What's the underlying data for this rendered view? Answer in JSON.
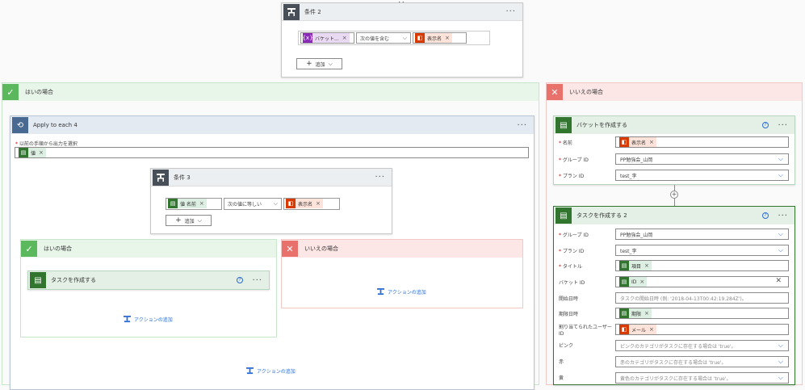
{
  "condition2": {
    "title": "条件 2",
    "token_left": "バケット...",
    "operator": "次の値を含む",
    "token_right": "表示名",
    "add_label": "追加"
  },
  "yes_branch": {
    "title": "はいの場合"
  },
  "no_branch": {
    "title": "いいえの場合"
  },
  "apply_each": {
    "title": "Apply to each 4",
    "select_label": "以前の手順から出力を選択",
    "token": "値"
  },
  "condition3": {
    "title": "条件 3",
    "token_left": "値 名前",
    "operator": "次の値に等しい",
    "token_right": "表示名",
    "add_label": "追加"
  },
  "inner_yes": {
    "title": "はいの場合",
    "task_title": "タスクを作成する",
    "add_action": "アクションの追加"
  },
  "inner_no": {
    "title": "いいえの場合",
    "add_action": "アクションの追加"
  },
  "outer_add_action": "アクションの追加",
  "create_bucket": {
    "title": "バケットを作成する",
    "name_label": "名前",
    "name_token": "表示名",
    "group_label": "グループ ID",
    "group_value": "PP勉強会_山岡",
    "plan_label": "プラン ID",
    "plan_value": "test_李"
  },
  "create_task2": {
    "title": "タスクを作成する 2",
    "group_label": "グループ ID",
    "group_value": "PP勉強会_山岡",
    "plan_label": "プラン ID",
    "plan_value": "test_李",
    "title_label": "タイトル",
    "title_token": "項目",
    "bucket_label": "バケット ID",
    "bucket_token": "ID",
    "start_label": "開始日時",
    "start_placeholder": "タスクの開始日時 (例: '2018-04-13T00:42:19.284Z')。",
    "due_label": "期限日時",
    "due_token": "期限",
    "assigned_label": "割り当てられたユーザー ID",
    "assigned_token": "メール",
    "pink_label": "ピンク",
    "pink_value": "ピンクのカテゴリがタスクに存在する場合は 'true'。",
    "red_label": "赤",
    "red_value": "赤のカテゴリがタスクに存在する場合は 'true'。",
    "yellow_label": "黄",
    "yellow_value": "黄色のカテゴリがタスクに存在する場合は 'true'。"
  },
  "colors": {
    "condition": "#484f58",
    "apply_each": "#486991",
    "planner": "#31752f",
    "yes": "#5cb85c",
    "no": "#e8716b",
    "link": "#2b6cd4"
  }
}
